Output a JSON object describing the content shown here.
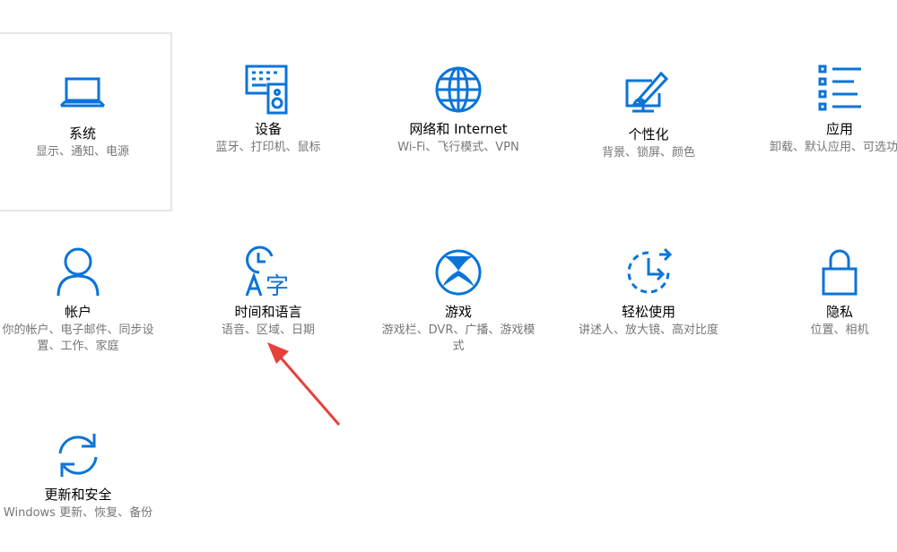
{
  "accent": "#0a74d9",
  "annotation_color": "#e8403a",
  "tiles": [
    {
      "title": "系统",
      "desc": "显示、通知、电源",
      "icon": "laptop-icon"
    },
    {
      "title": "设备",
      "desc": "蓝牙、打印机、鼠标",
      "icon": "keyboard-speaker-icon"
    },
    {
      "title": "网络和 Internet",
      "desc": "Wi-Fi、飞行模式、VPN",
      "icon": "globe-icon"
    },
    {
      "title": "个性化",
      "desc": "背景、锁屏、颜色",
      "icon": "paint-brush-icon"
    },
    {
      "title": "应用",
      "desc": "卸载、默认应用、可选功能",
      "icon": "app-list-icon"
    },
    {
      "title": "帐户",
      "desc": "你的帐户、电子邮件、同步设置、工作、家庭",
      "icon": "person-icon"
    },
    {
      "title": "时间和语言",
      "desc": "语音、区域、日期",
      "icon": "clock-language-icon"
    },
    {
      "title": "游戏",
      "desc": "游戏栏、DVR、广播、游戏模式",
      "icon": "xbox-icon"
    },
    {
      "title": "轻松使用",
      "desc": "讲述人、放大镜、高对比度",
      "icon": "ease-of-access-icon"
    },
    {
      "title": "隐私",
      "desc": "位置、相机",
      "icon": "lock-icon"
    },
    {
      "title": "更新和安全",
      "desc": "Windows 更新、恢复、备份",
      "icon": "sync-icon"
    }
  ]
}
